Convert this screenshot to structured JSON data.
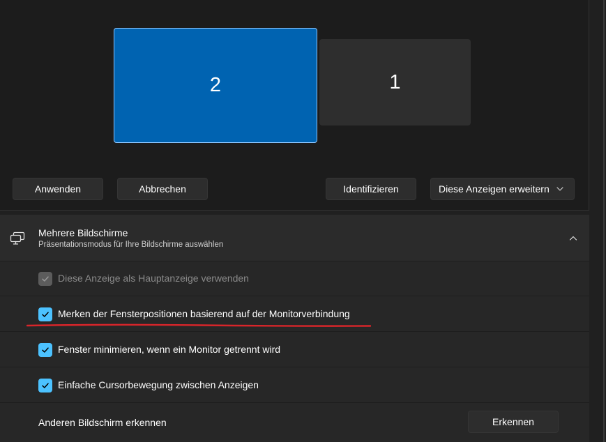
{
  "arrangement": {
    "monitors": [
      {
        "label": "2",
        "selected": true
      },
      {
        "label": "1",
        "selected": false
      }
    ],
    "apply_label": "Anwenden",
    "cancel_label": "Abbrechen",
    "identify_label": "Identifizieren",
    "mode_dropdown_value": "Diese Anzeigen erweitern"
  },
  "multiple_displays": {
    "title": "Mehrere Bildschirme",
    "subtitle": "Präsentationsmodus für Ihre Bildschirme auswählen",
    "expanded": true,
    "options": [
      {
        "label": "Diese Anzeige als Hauptanzeige verwenden",
        "checked": true,
        "disabled": true
      },
      {
        "label": "Merken der Fensterpositionen basierend auf der Monitorverbindung",
        "checked": true,
        "disabled": false
      },
      {
        "label": "Fenster minimieren, wenn ein Monitor getrennt wird",
        "checked": true,
        "disabled": false
      },
      {
        "label": "Einfache Cursorbewegung zwischen Anzeigen",
        "checked": true,
        "disabled": false
      }
    ],
    "detect_row_label": "Anderen Bildschirm erkennen",
    "detect_button_label": "Erkennen"
  },
  "colors": {
    "accent": "#4cc2ff",
    "selected_monitor": "#0063b1",
    "annotation_underline": "#d9252a"
  },
  "icons": {
    "section_icon": "multiple-displays-icon",
    "collapse_icon": "chevron-up-icon",
    "dropdown_icon": "chevron-down-icon",
    "check_icon": "checkmark-icon"
  }
}
